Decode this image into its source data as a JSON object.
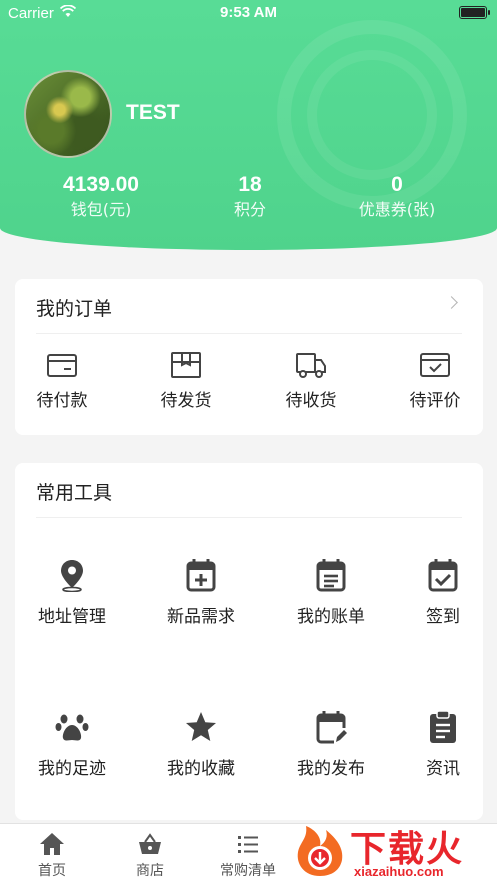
{
  "status_bar": {
    "carrier": "Carrier",
    "time": "9:53 AM"
  },
  "profile": {
    "username": "TEST"
  },
  "stats": [
    {
      "value": "4139.00",
      "label": "钱包(元)"
    },
    {
      "value": "18",
      "label": "积分"
    },
    {
      "value": "0",
      "label": "优惠券(张)"
    }
  ],
  "orders": {
    "title": "我的订单",
    "items": [
      {
        "label": "待付款",
        "icon": "wallet-card-icon"
      },
      {
        "label": "待发货",
        "icon": "package-box-icon"
      },
      {
        "label": "待收货",
        "icon": "delivery-truck-icon"
      },
      {
        "label": "待评价",
        "icon": "review-check-icon"
      }
    ]
  },
  "tools": {
    "title": "常用工具",
    "items": [
      {
        "label": "地址管理",
        "icon": "location-pin-icon"
      },
      {
        "label": "新品需求",
        "icon": "calendar-plus-icon"
      },
      {
        "label": "我的账单",
        "icon": "bill-calendar-icon"
      },
      {
        "label": "签到",
        "icon": "calendar-check-icon"
      },
      {
        "label": "我的足迹",
        "icon": "paw-print-icon"
      },
      {
        "label": "我的收藏",
        "icon": "star-icon"
      },
      {
        "label": "我的发布",
        "icon": "calendar-edit-icon"
      },
      {
        "label": "资讯",
        "icon": "clipboard-icon"
      }
    ]
  },
  "tabbar": [
    {
      "label": "首页",
      "icon": "home-icon"
    },
    {
      "label": "商店",
      "icon": "shopping-basket-icon"
    },
    {
      "label": "常购清单",
      "icon": "list-icon"
    }
  ],
  "watermark": {
    "text": "下载火",
    "sub": "xiazaihuo.com"
  },
  "colors": {
    "accent": "#55d993",
    "brand_red": "#e8262c",
    "icon_dark": "#444444"
  }
}
